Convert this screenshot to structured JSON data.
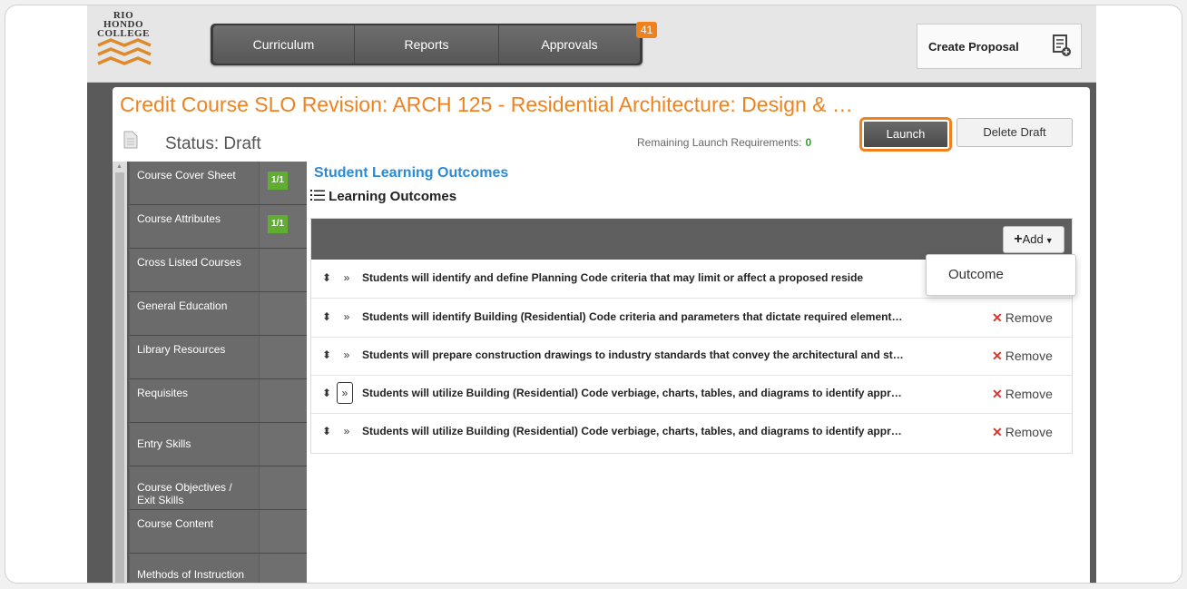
{
  "logo": {
    "line1": "RIO",
    "line2": "HONDO",
    "line3": "COLLEGE"
  },
  "nav": {
    "items": [
      {
        "label": "Curriculum"
      },
      {
        "label": "Reports"
      },
      {
        "label": "Approvals"
      }
    ],
    "badge": "41"
  },
  "header": {
    "create_label": "Create Proposal"
  },
  "page": {
    "title": "Credit Course SLO Revision: ARCH 125 - Residential Architecture: Design & …",
    "status": "Status: Draft",
    "remaining_label": "Remaining Launch Requirements:",
    "remaining_value": "0",
    "launch_label": "Launch",
    "delete_label": "Delete Draft"
  },
  "sidebar": {
    "items": [
      {
        "label": "Course Cover Sheet",
        "count": "1/1"
      },
      {
        "label": "Course Attributes",
        "count": "1/1"
      },
      {
        "label": "Cross Listed Courses"
      },
      {
        "label": "General Education"
      },
      {
        "label": "Library Resources"
      },
      {
        "label": "Requisites"
      },
      {
        "label": "Entry Skills"
      },
      {
        "label": "Course Objectives / Exit Skills"
      },
      {
        "label": "Course Content"
      },
      {
        "label": "Methods of Instruction"
      }
    ]
  },
  "content": {
    "section_title": "Student Learning Outcomes",
    "subsection_title": "Learning Outcomes",
    "add_label": "Add",
    "remove_label": "Remove",
    "outcomes": [
      "Students will identify and define Planning Code criteria that may limit or affect a proposed reside",
      "Students will identify Building (Residential) Code criteria and parameters that dictate required element…",
      "Students will prepare construction drawings to industry standards that convey the architectural and st…",
      "Students will utilize Building (Residential) Code verbiage, charts, tables, and diagrams to identify appr…",
      "Students will utilize Building (Residential) Code verbiage, charts, tables, and diagrams to identify appr…"
    ]
  },
  "dropdown": {
    "option": "Outcome"
  },
  "colors": {
    "accent": "#f0821e",
    "link": "#2b8bd6",
    "badge_green": "#5fae2f",
    "remove": "#d9342b"
  }
}
